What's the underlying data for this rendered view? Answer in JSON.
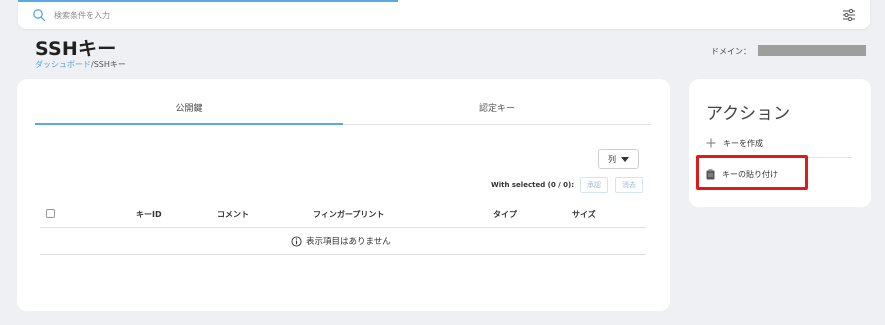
{
  "search": {
    "placeholder": "検索条件を入力"
  },
  "header": {
    "title": "SSHキー",
    "breadcrumb": {
      "home_label": "ダッシュボード",
      "separator": "/",
      "current": "SSHキー"
    },
    "domain_label": "ドメイン："
  },
  "main": {
    "tabs": [
      {
        "label": "公開鍵"
      },
      {
        "label": "認定キー"
      }
    ],
    "columns_button": "列",
    "with_selected": "With selected (0 / 0):",
    "approve_label": "承認",
    "delete_label": "消去",
    "table": {
      "headers": [
        "キーID",
        "コメント",
        "フィンガープリント",
        "タイプ",
        "サイズ"
      ],
      "empty_message": "表示項目はありません"
    }
  },
  "sidebar": {
    "title": "アクション",
    "actions": [
      {
        "label": "キーを作成",
        "icon": "plus-icon"
      },
      {
        "label": "キーの貼り付け",
        "icon": "clipboard-icon"
      }
    ]
  },
  "colors": {
    "accent": "#5aa9e6",
    "highlight": "#e0191b",
    "background": "#eef0f3"
  }
}
